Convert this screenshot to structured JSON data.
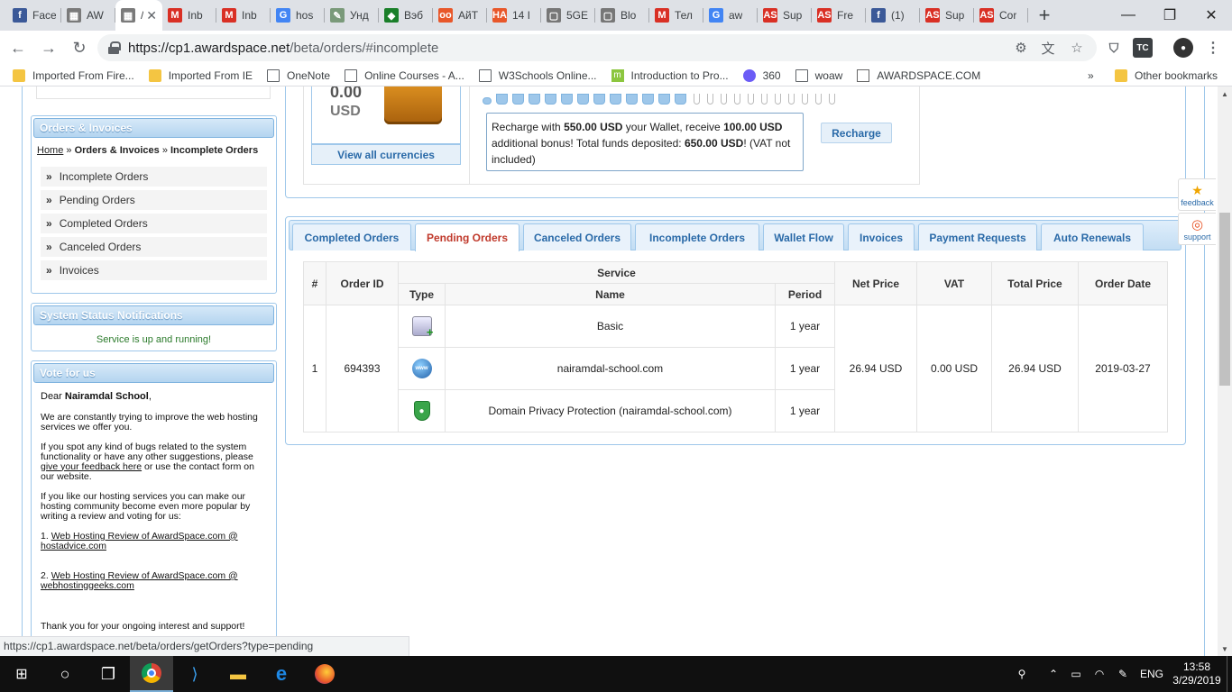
{
  "browser": {
    "tabs": [
      {
        "title": "Face",
        "fav": "f",
        "favcolor": "#3b5998"
      },
      {
        "title": "AW",
        "fav": "▦",
        "favcolor": "#7a7a7a"
      },
      {
        "title": "/",
        "fav": "▦",
        "favcolor": "#7a7a7a",
        "active": true
      },
      {
        "title": "Inb",
        "fav": "M",
        "favcolor": "#d93025"
      },
      {
        "title": "Inb",
        "fav": "M",
        "favcolor": "#d93025"
      },
      {
        "title": "hos",
        "fav": "G",
        "favcolor": "#4285f4"
      },
      {
        "title": "Унд",
        "fav": "✎",
        "favcolor": "#7a9a7a"
      },
      {
        "title": "Вэб",
        "fav": "◆",
        "favcolor": "#1a7f2a"
      },
      {
        "title": "АйТ",
        "fav": "oo",
        "favcolor": "#e8572a"
      },
      {
        "title": "14 I",
        "fav": "HA",
        "favcolor": "#e8572a"
      },
      {
        "title": "5GE",
        "fav": "▢",
        "favcolor": "#777"
      },
      {
        "title": "Blo",
        "fav": "▢",
        "favcolor": "#777"
      },
      {
        "title": "Тел",
        "fav": "M",
        "favcolor": "#d93025"
      },
      {
        "title": "aw",
        "fav": "G",
        "favcolor": "#4285f4"
      },
      {
        "title": "Sup",
        "fav": "AS",
        "favcolor": "#d93025"
      },
      {
        "title": "Fre",
        "fav": "AS",
        "favcolor": "#d93025"
      },
      {
        "title": "(1)",
        "fav": "f",
        "favcolor": "#3b5998"
      },
      {
        "title": "Sup",
        "fav": "AS",
        "favcolor": "#d93025"
      },
      {
        "title": "Cor",
        "fav": "AS",
        "favcolor": "#d93025"
      }
    ],
    "url_host": "https://cp1.awardspace.net",
    "url_path": "/beta/orders/#incomplete",
    "bookmarks": [
      {
        "label": "Imported From Fire...",
        "type": "folder"
      },
      {
        "label": "Imported From IE",
        "type": "folder"
      },
      {
        "label": "OneNote",
        "type": "page"
      },
      {
        "label": "Online Courses - A...",
        "type": "page"
      },
      {
        "label": "W3Schools Online...",
        "type": "page"
      },
      {
        "label": "Introduction to Pro...",
        "type": "m"
      },
      {
        "label": "360",
        "type": "circle"
      },
      {
        "label": "woaw",
        "type": "page"
      },
      {
        "label": "AWARDSPACE.COM",
        "type": "grid"
      }
    ],
    "more_bookmarks": "»",
    "other_bookmarks": "Other bookmarks",
    "status_url": "https://cp1.awardspace.net/beta/orders/getOrders?type=pending"
  },
  "sidebar": {
    "orders_title": "Orders & Invoices",
    "breadcrumb_home": "Home",
    "breadcrumb_sep": "»",
    "breadcrumb_section": "Orders & Invoices",
    "breadcrumb_current": "Incomplete Orders",
    "menu": [
      "Incomplete Orders",
      "Pending Orders",
      "Completed Orders",
      "Canceled Orders",
      "Invoices"
    ],
    "status_title": "System Status Notifications",
    "status_text": "Service is up and running!",
    "vote_title": "Vote for us",
    "vote_greeting": "Dear",
    "vote_name": "Nairamdal School",
    "vote_p1": "We are constantly trying to improve the web hosting services we offer you.",
    "vote_p2a": "If you spot any kind of bugs related to the system functionality or have any other suggestions, please",
    "vote_p2_link": "give your feedback here",
    "vote_p2b": "or use the contact form on our website.",
    "vote_p3": "If you like our hosting services you can make our hosting community become even more popular by writing a review and voting for us:",
    "vote_link1_num": "1.",
    "vote_link1": "Web Hosting Review of AwardSpace.com @ hostadvice.com",
    "vote_link2_num": "2.",
    "vote_link2": "Web Hosting Review of AwardSpace.com @ webhostinggeeks.com",
    "vote_thanks": "Thank you for your ongoing interest and support!"
  },
  "wallet": {
    "amount": "0.00",
    "currency": "USD",
    "view_all": "View all currencies",
    "recharge_pre": "Recharge with",
    "recharge_amount": "550.00 USD",
    "recharge_mid": "your Wallet, receive",
    "bonus_amount": "100.00 USD",
    "recharge_mid2": "additional bonus! Total funds deposited:",
    "total_amount": "650.00 USD",
    "recharge_post": "! (VAT not included)",
    "recharge_button": "Recharge",
    "progress_filled": 13,
    "progress_total": 24
  },
  "order_tabs": [
    {
      "label": "Completed Orders"
    },
    {
      "label": "Pending Orders",
      "active": true
    },
    {
      "label": "Canceled Orders"
    },
    {
      "label": "Incomplete Orders"
    },
    {
      "label": "Wallet Flow"
    },
    {
      "label": "Invoices"
    },
    {
      "label": "Payment Requests"
    },
    {
      "label": "Auto Renewals"
    }
  ],
  "table": {
    "headers": {
      "num": "#",
      "order_id": "Order ID",
      "service": "Service",
      "type": "Type",
      "name": "Name",
      "period": "Period",
      "net": "Net Price",
      "vat": "VAT",
      "total": "Total Price",
      "date": "Order Date"
    },
    "order": {
      "num": "1",
      "order_id": "694393",
      "net": "26.94 USD",
      "vat": "0.00 USD",
      "total": "26.94 USD",
      "date": "2019-03-27",
      "items": [
        {
          "icon": "hosting-plan-icon",
          "name": "Basic",
          "period": "1 year"
        },
        {
          "icon": "domain-www-icon",
          "name": "nairamdal-school.com",
          "period": "1 year"
        },
        {
          "icon": "privacy-shield-icon",
          "name": "Domain Privacy Protection (nairamdal-school.com)",
          "period": "1 year"
        }
      ]
    }
  },
  "widgets": {
    "feedback": "feedback",
    "support": "support"
  },
  "taskbar": {
    "language": "ENG",
    "time": "13:58",
    "date": "3/29/2019"
  }
}
